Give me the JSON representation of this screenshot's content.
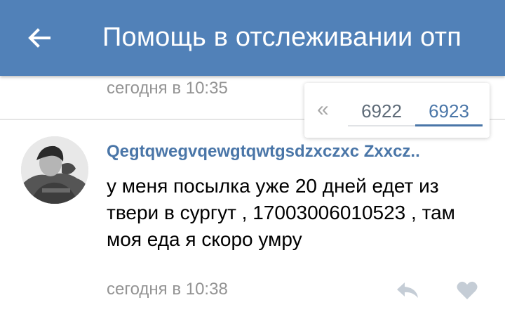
{
  "header": {
    "title": "Помощь в отслеживании отп",
    "back_icon": "arrow-left-icon",
    "background": "#5181b8"
  },
  "previous_comment": {
    "time": "сегодня в 10:35"
  },
  "pager": {
    "rewind_icon": "double-chevron-left-icon",
    "pages": [
      "6922",
      "6923"
    ],
    "current": "6923",
    "accent": "#4a76a8"
  },
  "comment": {
    "author": "Qegtqwegvqewgtqwtgsdzxczxc Zxxcz..",
    "text": "у меня посылка уже 20 дней едет из твери в сургут , 17003006010523 , там моя еда я скоро умру",
    "time": "сегодня в 10:38",
    "reply_icon": "reply-icon",
    "like_icon": "heart-icon"
  }
}
